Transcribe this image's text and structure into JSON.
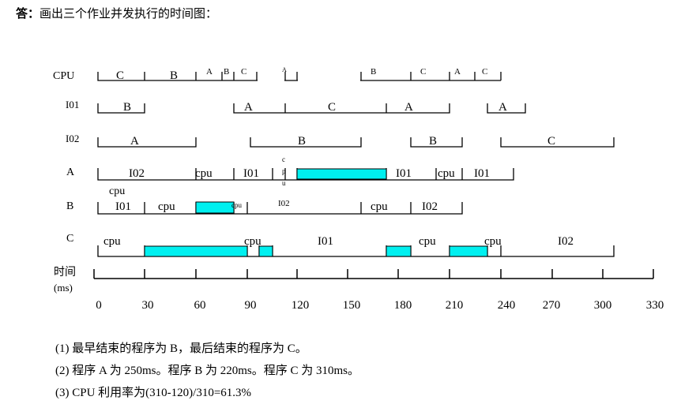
{
  "heading": {
    "prefix": "答",
    "colon": "：",
    "text": "画出三个作业并发执行的时间图："
  },
  "rows": {
    "cpu": "CPU",
    "io1": "I01",
    "io2": "I02",
    "a": "A",
    "b": "B",
    "c": "C",
    "time_label_1": "时间",
    "time_label_2": "(ms)"
  },
  "segments": {
    "cpu": [
      "C",
      "B",
      "A",
      "B",
      "C",
      "A",
      "B",
      "C",
      "A",
      "C"
    ],
    "io1": [
      "B",
      "A",
      "C",
      "A",
      "A"
    ],
    "io2": [
      "A",
      "B",
      "B",
      "C"
    ],
    "a": [
      "I02",
      "cpu",
      "I01",
      "c",
      "p",
      "u",
      "I01",
      "cpu",
      "I01"
    ],
    "b": [
      "cpu",
      "I01",
      "cpu",
      "cpu",
      "I02",
      "cpu",
      "I02"
    ],
    "c": [
      "cpu",
      "cpu",
      "I01",
      "cpu",
      "cpu",
      "I02"
    ]
  },
  "ticks": [
    "0",
    "30",
    "60",
    "90",
    "120",
    "150",
    "180",
    "210",
    "240",
    "270",
    "300",
    "330"
  ],
  "colors": {
    "wait_fill": "#00f0f0"
  },
  "answers": [
    "(1)  最早结束的程序为 B，最后结束的程序为 C。",
    "(2)  程序 A 为 250ms。程序 B 为 220ms。程序 C 为 310ms。",
    "(3)  CPU 利用率为(310-120)/310=61.3%"
  ]
}
